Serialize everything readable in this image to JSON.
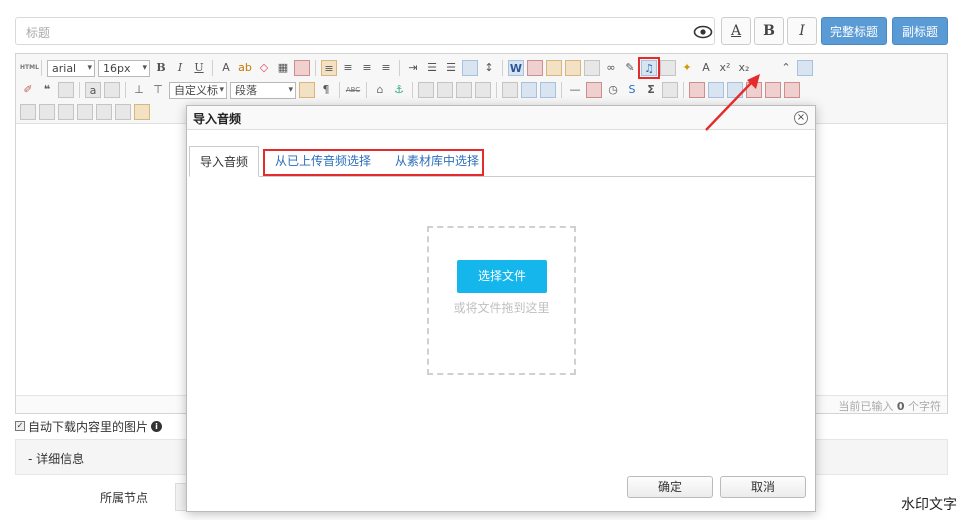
{
  "title_bar": {
    "placeholder": "标题",
    "underline_label": "A",
    "bold_label": "B",
    "italic_label": "I",
    "full_title_button": "完整标题",
    "subtitle_button": "副标题"
  },
  "toolbar": {
    "font_family": "arial",
    "font_size": "16px",
    "custom_title_select": "自定义标",
    "paragraph_select": "段落",
    "icons": [
      "html-icon",
      "font-color-icon",
      "highlight-icon",
      "eraser-icon",
      "grid-icon",
      "table-icon",
      "word-icon",
      "pdf-icon",
      "image-icon",
      "link-icon",
      "attachment-icon",
      "music-icon",
      "video-icon",
      "sigma-icon"
    ]
  },
  "status": {
    "prefix": "当前已输入",
    "count": "0",
    "suffix": "个字符"
  },
  "auto_download": {
    "label": "自动下载内容里的图片"
  },
  "detail_section": {
    "label": "-  详细信息"
  },
  "node_field": {
    "label": "所属节点"
  },
  "dialog": {
    "title": "导入音频",
    "tabs": [
      {
        "label": "导入音频"
      },
      {
        "label": "从已上传音频选择"
      },
      {
        "label": "从素材库中选择"
      }
    ],
    "choose_button": "选择文件",
    "drop_hint": "或将文件拖到这里",
    "ok_button": "确定",
    "cancel_button": "取消"
  },
  "watermark": "水印文字",
  "colors": {
    "accent_blue": "#15b6ec",
    "header_button_blue": "#5b9bd5",
    "highlight_red": "#e52b2b",
    "link_blue": "#2a6ebb"
  }
}
